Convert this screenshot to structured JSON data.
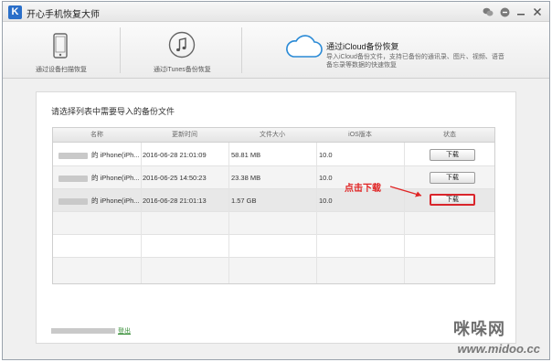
{
  "app": {
    "logo_letter": "K",
    "title": "开心手机恢复大师"
  },
  "modes": [
    {
      "label": "通过设备扫描恢复"
    },
    {
      "label": "通过iTunes备份恢复"
    },
    {
      "title": "通过iCloud备份恢复",
      "desc": "导入iCloud备份文件，支持已备份的通讯录、图片、视频、语音备忘录等数据的快速恢复"
    }
  ],
  "main": {
    "prompt": "请选择列表中需要导入的备份文件",
    "columns": [
      "名称",
      "更新时间",
      "文件大小",
      "iOS版本",
      "状态"
    ],
    "rows": [
      {
        "name": "的 iPhone(iPh...",
        "time": "2016-06-28 21:01:09",
        "size": "58.81 MB",
        "ios": "10.0",
        "action": "下载"
      },
      {
        "name": "的 iPhone(iPh...",
        "time": "2016-06-25 14:50:23",
        "size": "23.38 MB",
        "ios": "10.0",
        "action": "下载"
      },
      {
        "name": "的 iPhone(iPh...",
        "time": "2016-06-28 21:01:13",
        "size": "1.57 GB",
        "ios": "10.0",
        "action": "下载"
      }
    ],
    "annotation": "点击下载",
    "logout": "登出"
  },
  "watermark": {
    "cn": "咪哚网",
    "url": "www.midoo.cc"
  },
  "colors": {
    "accent": "#2a6fc9",
    "highlight": "#d9252b",
    "link": "#2f8a2f"
  }
}
